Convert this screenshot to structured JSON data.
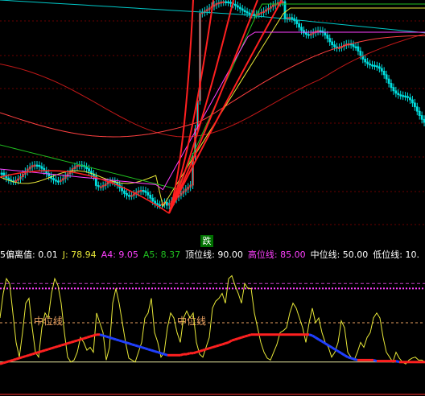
{
  "chart_data": [
    {
      "type": "candlestick",
      "panel": "price",
      "signal_label": "跌",
      "grid": "dashed-horizontal",
      "colors": {
        "up": "#00ffff",
        "down": "#00ffff",
        "fan_lines": "#ff2020",
        "ma_slow": "#c01818",
        "ma_mid": "#ff4040",
        "ma_fast": "#00c8c8",
        "ma_yellow": "#e8e838",
        "ma_green": "#20c020",
        "ma_magenta": "#ff40ff",
        "signal_bg": "#007000",
        "signal_text": "#ffffff"
      }
    },
    {
      "type": "line",
      "panel": "indicator",
      "header": [
        {
          "text": "5偏离值:",
          "value": "0.01",
          "color": "#ffffff"
        },
        {
          "text": "J:",
          "value": "78.94",
          "color": "#e8e838"
        },
        {
          "text": "A4:",
          "value": "9.05",
          "color": "#ff40ff"
        },
        {
          "text": "A5:",
          "value": "8.37",
          "color": "#20c020"
        },
        {
          "text": "顶位线:",
          "value": "90.00",
          "color": "#ffffff"
        },
        {
          "text": "高位线:",
          "value": "85.00",
          "color": "#ff40ff"
        },
        {
          "text": "中位线:",
          "value": "50.00",
          "color": "#ffffff"
        },
        {
          "text": "低位线:",
          "value": "10.",
          "color": "#ffffff"
        }
      ],
      "annotations": [
        {
          "text": "中位线",
          "color": "#e8a060"
        },
        {
          "text": "中位线",
          "color": "#e8a060"
        }
      ],
      "levels": {
        "top": 90,
        "high": 85,
        "mid": 50,
        "low": 10
      },
      "ylim": [
        0,
        105
      ],
      "series": [
        {
          "values": [
            55,
            80,
            95,
            90,
            60,
            30,
            15,
            40,
            70,
            75,
            45,
            20,
            15,
            45,
            60,
            55,
            80,
            95,
            88,
            70,
            40,
            15,
            10,
            12,
            20,
            35,
            30,
            22,
            25,
            20,
            60,
            50,
            40,
            12,
            25,
            70,
            85,
            70,
            50,
            30,
            14,
            12,
            10,
            20,
            30,
            55,
            60,
            75,
            40,
            30,
            15,
            20,
            45,
            60,
            55,
            40,
            30,
            55,
            62,
            55,
            60,
            30,
            18,
            15,
            25,
            35,
            65,
            72,
            75,
            80,
            70,
            95,
            98,
            88,
            80,
            70,
            90,
            85,
            85,
            60,
            45,
            30,
            20,
            14,
            12,
            20,
            28,
            40,
            42,
            45,
            60,
            70,
            65,
            55,
            45,
            30,
            50,
            65,
            50,
            55,
            40,
            30,
            25,
            15,
            20,
            30,
            52,
            45,
            20,
            15,
            12,
            20,
            30,
            25,
            35,
            40,
            55,
            60,
            55,
            35,
            20,
            15,
            10,
            20,
            14,
            10,
            8,
            12,
            14,
            15,
            12,
            12,
            10
          ]
        },
        {
          "values": [
            8,
            9,
            10,
            11,
            12,
            13,
            14,
            15,
            16,
            17,
            18,
            19,
            20,
            21,
            22,
            23,
            24,
            25,
            26,
            27,
            28,
            29,
            30,
            31,
            32,
            33,
            34,
            35,
            36,
            37,
            38,
            38,
            37,
            36,
            35,
            34,
            33,
            32,
            31,
            30,
            29,
            28,
            27,
            26,
            25,
            24,
            23,
            22,
            21,
            20,
            19,
            18,
            17,
            17,
            17,
            17,
            17,
            18,
            18,
            19,
            19,
            20,
            21,
            22,
            23,
            24,
            25,
            26,
            27,
            28,
            29,
            30,
            32,
            33,
            34,
            35,
            36,
            37,
            38,
            38,
            38,
            38,
            38,
            38,
            38,
            38,
            38,
            38,
            38,
            38,
            38,
            38,
            38,
            38,
            38,
            38,
            38,
            37,
            35,
            33,
            31,
            29,
            27,
            25,
            23,
            21,
            19,
            17,
            15,
            14,
            13,
            12,
            12,
            12,
            12,
            12,
            12,
            11,
            11,
            11,
            11,
            11,
            11,
            11,
            10,
            10,
            10,
            10,
            10,
            10,
            10,
            10,
            10
          ]
        }
      ]
    }
  ]
}
